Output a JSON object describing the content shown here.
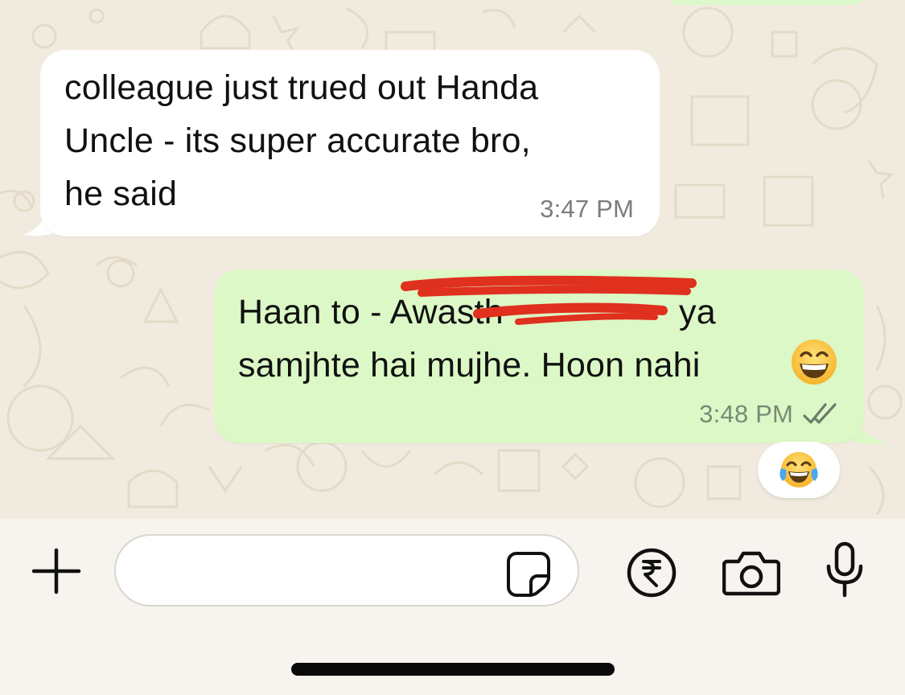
{
  "chat": {
    "messages": [
      {
        "direction": "incoming",
        "text": "colleague just trued out Handa\nUncle - its super accurate bro,\nhe said",
        "time": "3:47 PM"
      },
      {
        "direction": "outgoing",
        "text": "Haan to - Awasth\nsamjhte hai mujhe. Hoon nahi",
        "text_after_redaction": "ya",
        "trailing_emoji": "grinning-face-with-smiling-eyes",
        "time": "3:48 PM",
        "status": "read-double-check",
        "reaction": "face-with-tears-of-joy"
      }
    ]
  },
  "composer": {
    "message_value": "",
    "icons": [
      "plus-icon",
      "sticker-icon",
      "rupee-icon",
      "camera-icon",
      "microphone-icon"
    ]
  },
  "colors": {
    "incoming_bubble": "#ffffff",
    "outgoing_bubble": "#dcf8c6",
    "wallpaper": "#f1ebdf",
    "redaction": "#e0301e"
  }
}
